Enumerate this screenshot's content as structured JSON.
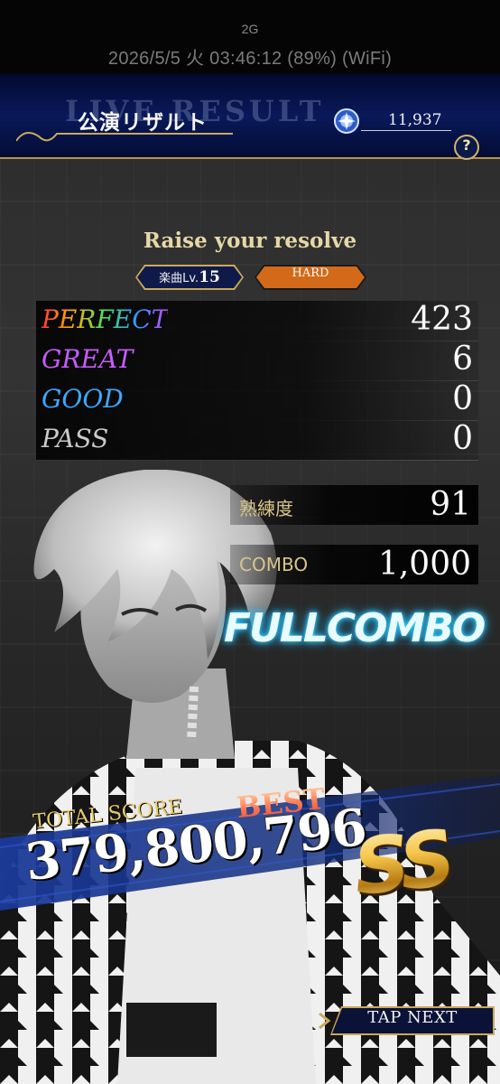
{
  "status_bar": {
    "network": "2G",
    "datetime_battery": "2026/5/5 火 03:46:12 (89%) (WiFi)"
  },
  "header": {
    "title": "公演リザルト",
    "ghost_text": "LIVE RESULT",
    "currency_value": "11,937",
    "help_label": "?"
  },
  "song": {
    "title": "Raise your resolve",
    "level_label": "楽曲Lv.",
    "level_value": "15",
    "difficulty": "HARD"
  },
  "judgements": [
    {
      "label": "PERFECT",
      "value": "423"
    },
    {
      "label": "GREAT",
      "value": "6"
    },
    {
      "label": "GOOD",
      "value": "0"
    },
    {
      "label": "PASS",
      "value": "0"
    }
  ],
  "proficiency": {
    "label": "熟練度",
    "value": "91"
  },
  "combo": {
    "label": "COMBO",
    "value": "1,000",
    "badge": "FULLCOMBO"
  },
  "score": {
    "total_label": "TOTAL SCORE",
    "best_label": "BEST",
    "value": "379,800,796",
    "rank": "SS"
  },
  "tap_next": "TAP NEXT",
  "colors": {
    "header_navy": "#09195a",
    "gold": "#c9a95a",
    "hard_orange": "#d26a1a",
    "fullcombo_cyan": "#38d5ff"
  }
}
